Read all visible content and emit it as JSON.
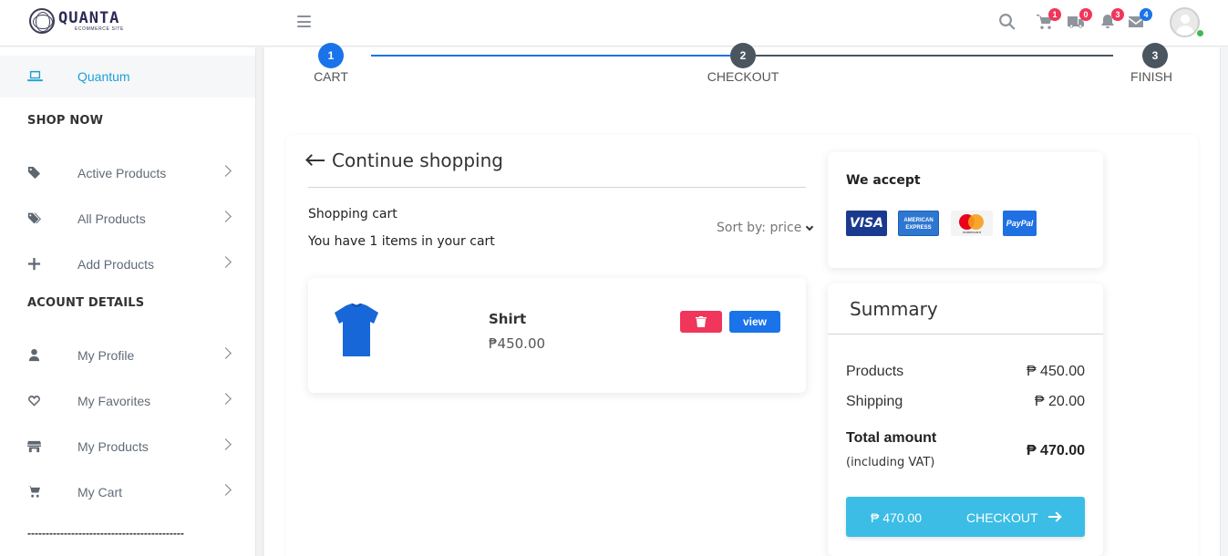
{
  "header": {
    "logo_name": "QUANTA",
    "logo_sub": "ECOMMERCE SITE",
    "badges": {
      "cart": "1",
      "delivery": "0",
      "notifications": "3",
      "messages": "4"
    },
    "badge_colors": {
      "cart": "#f0365a",
      "delivery": "#f0365a",
      "notifications": "#f0365a",
      "messages": "#1a73e8"
    }
  },
  "sidebar": {
    "active_item": {
      "label": "Quantum",
      "icon": "laptop-icon"
    },
    "section_shop": "SHOP NOW",
    "shop_items": [
      {
        "label": "Active Products",
        "icon": "tag-icon"
      },
      {
        "label": "All Products",
        "icon": "tags-icon"
      },
      {
        "label": "Add Products",
        "icon": "plus-icon"
      }
    ],
    "section_account": "ACOUNT DETAILS",
    "account_items": [
      {
        "label": "My Profile",
        "icon": "user-icon"
      },
      {
        "label": "My Favorites",
        "icon": "heart-icon"
      },
      {
        "label": "My Products",
        "icon": "store-icon"
      },
      {
        "label": "My Cart",
        "icon": "cart-icon"
      }
    ],
    "divider": "-------------------------------------------"
  },
  "progress": {
    "steps": [
      {
        "number": "1",
        "label": "CART"
      },
      {
        "number": "2",
        "label": "CHECKOUT"
      },
      {
        "number": "3",
        "label": "FINISH"
      }
    ],
    "colors": {
      "done": "#1a73e8",
      "pending": "#4a5560"
    }
  },
  "cart": {
    "continue_label": "Continue shopping",
    "title": "Shopping cart",
    "count_text": "You have 1 items in your cart",
    "sort_label": "Sort by: price",
    "items": [
      {
        "name": "Shirt",
        "price": "₱450.00",
        "view_label": "view"
      }
    ]
  },
  "payment": {
    "title": "We accept",
    "methods": [
      "VISA",
      "AMERICAN EXPRESS",
      "mastercard",
      "PayPal"
    ]
  },
  "summary": {
    "title": "Summary",
    "products_label": "Products",
    "products_value": "₱ 450.00",
    "shipping_label": "Shipping",
    "shipping_value": "₱ 20.00",
    "total_label": "Total amount",
    "total_sub": "(including VAT)",
    "total_value": "₱ 470.00",
    "checkout_amount": "₱ 470.00",
    "checkout_label": "CHECKOUT"
  }
}
